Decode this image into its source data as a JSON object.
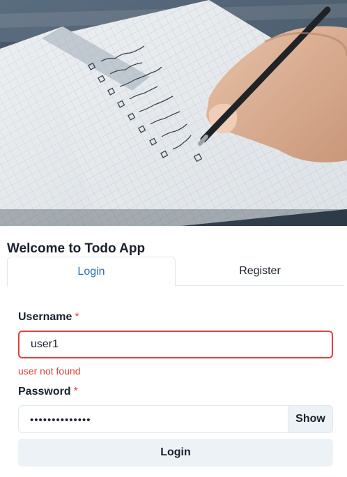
{
  "hero": {
    "image": "notebook-checklist-photo"
  },
  "app": {
    "title": "Welcome to Todo App"
  },
  "tabs": [
    {
      "label": "Login",
      "selected": true
    },
    {
      "label": "Register",
      "selected": false
    }
  ],
  "form": {
    "username": {
      "label": "Username",
      "required_mark": "*",
      "value": "user1",
      "error": "user not found"
    },
    "password": {
      "label": "Password",
      "required_mark": "*",
      "value": "••••••••••••••",
      "toggle_label": "Show"
    },
    "submit_label": "Login"
  },
  "colors": {
    "accent": "#2b6cb0",
    "error": "#e53e3e",
    "button_bg": "#edf2f7",
    "border": "#e2e8f0"
  }
}
